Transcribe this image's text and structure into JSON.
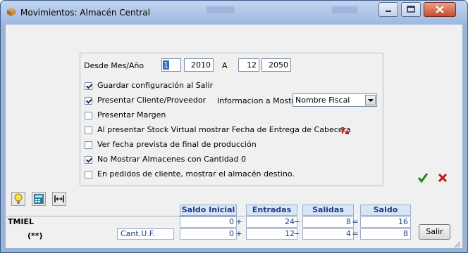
{
  "window": {
    "title": "Movimientos: Almacén Central"
  },
  "range": {
    "desde_label": "Desde Mes/Año",
    "from_month": "1",
    "from_year": "2010",
    "a_label": "A",
    "to_month": "12",
    "to_year": "2050"
  },
  "options": [
    {
      "label": "Guardar configuración al Salir",
      "checked": true
    },
    {
      "label": "Presentar Cliente/Proveedor",
      "checked": true
    },
    {
      "label": "Presentar Margen",
      "checked": false
    },
    {
      "label": "Al presentar Stock Virtual mostrar Fecha de Entrega de Cabecera",
      "checked": false
    },
    {
      "label": "Ver fecha prevista de final de producción",
      "checked": false
    },
    {
      "label": "No Mostrar Almacenes con Cantidad 0",
      "checked": true
    },
    {
      "label": "En pedidos de cliente, mostrar el almacén destino.",
      "checked": false
    }
  ],
  "info_mostrar": {
    "label": "Informacion a Mostrar",
    "value": "Nombre Fiscal"
  },
  "summary": {
    "headers": [
      "Saldo Inicial",
      "Entradas",
      "Salidas",
      "Saldo"
    ],
    "row1_label": "TMIEL",
    "row2_label": "(**)",
    "row2_sublabel": "Cant.U.F.",
    "row1": {
      "saldo_inicial": "0",
      "entradas": "24",
      "salidas": "8",
      "saldo": "16"
    },
    "row2": {
      "saldo_inicial": "0",
      "entradas": "12",
      "salidas": "4",
      "saldo": "8"
    },
    "ops": [
      "+",
      "−",
      "="
    ]
  },
  "buttons": {
    "salir": "Salir"
  },
  "colors": {
    "accent": "#1f3a80",
    "confirm": "#1a8a1a",
    "cancel": "#c01818"
  }
}
